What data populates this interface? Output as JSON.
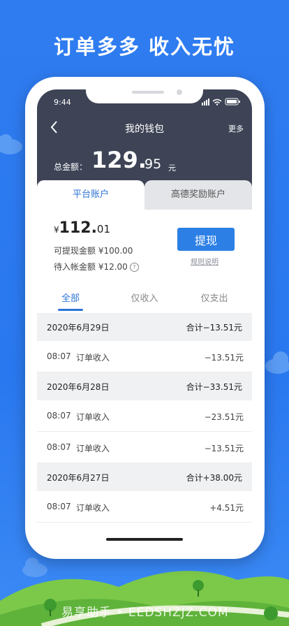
{
  "promo": {
    "tagline": "订单多多 收入无忧"
  },
  "status_bar": {
    "time": "9:44"
  },
  "nav": {
    "title": "我的钱包",
    "more": "更多"
  },
  "summary": {
    "label": "总金额：",
    "amount_int": "129.",
    "amount_dec": "95",
    "unit": "元"
  },
  "account_tabs": [
    {
      "label": "平台账户"
    },
    {
      "label": "高德奖励账户"
    }
  ],
  "balance": {
    "currency": "¥",
    "int": "112.",
    "dec": "01",
    "available": "可提现金额 ¥100.00",
    "pending": "待入帐金额 ¥12.00",
    "help_icon": "?"
  },
  "actions": {
    "withdraw": "提现",
    "rules": "规则说明"
  },
  "filters": [
    {
      "label": "全部"
    },
    {
      "label": "仅收入"
    },
    {
      "label": "仅支出"
    }
  ],
  "days": [
    {
      "date": "2020年6月29日",
      "total": "合计−13.51元",
      "items": [
        {
          "time": "08:07",
          "label": "订单收入",
          "amount": "−13.51元"
        }
      ]
    },
    {
      "date": "2020年6月28日",
      "total": "合计−33.51元",
      "items": [
        {
          "time": "08:07",
          "label": "订单收入",
          "amount": "−23.51元"
        },
        {
          "time": "08:07",
          "label": "订单收入",
          "amount": "−13.51元"
        }
      ]
    },
    {
      "date": "2020年6月27日",
      "total": "合计+38.00元",
      "items": [
        {
          "time": "08:07",
          "label": "订单收入",
          "amount": "+4.51元"
        }
      ]
    }
  ],
  "watermark": "易享助手 • EEDSHZJZ.COM"
}
